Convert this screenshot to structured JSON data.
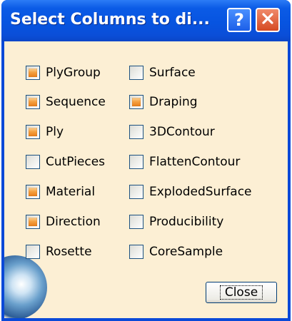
{
  "window": {
    "title": "Select Columns to di...",
    "help_label": "?",
    "close_label": "✕"
  },
  "columns": {
    "left": [
      {
        "label": "PlyGroup",
        "checked": true
      },
      {
        "label": "Sequence",
        "checked": true
      },
      {
        "label": "Ply",
        "checked": true
      },
      {
        "label": "CutPieces",
        "checked": false
      },
      {
        "label": "Material",
        "checked": true
      },
      {
        "label": "Direction",
        "checked": true
      },
      {
        "label": "Rosette",
        "checked": false
      }
    ],
    "right": [
      {
        "label": "Surface",
        "checked": false
      },
      {
        "label": "Draping",
        "checked": true
      },
      {
        "label": "3DContour",
        "checked": false
      },
      {
        "label": "FlattenContour",
        "checked": false
      },
      {
        "label": "ExplodedSurface",
        "checked": false
      },
      {
        "label": "Producibility",
        "checked": false
      },
      {
        "label": "CoreSample",
        "checked": false
      }
    ]
  },
  "footer": {
    "close_label": "Close"
  },
  "colors": {
    "titlebar": "#0754e0",
    "client_bg": "#fcefd4",
    "check_fill": "#f5a142"
  }
}
